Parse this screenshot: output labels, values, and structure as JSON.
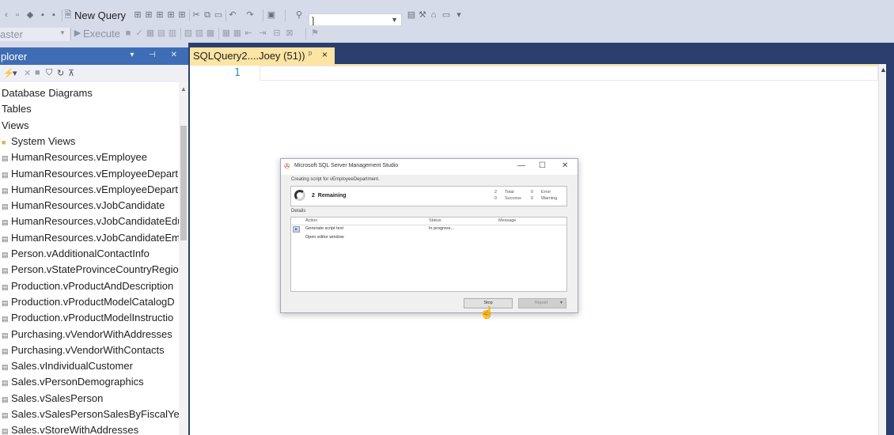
{
  "toolbar": {
    "new_query_label": "New Query",
    "execute_label": "Execute",
    "database_combo_value": "aster",
    "search_combo_value": "]"
  },
  "object_explorer": {
    "title": "plorer",
    "items": [
      {
        "label": "Database Diagrams",
        "icon": "none"
      },
      {
        "label": "Tables",
        "icon": "none"
      },
      {
        "label": "Views",
        "icon": "none"
      },
      {
        "label": "System Views",
        "icon": "folder-icon"
      },
      {
        "label": "HumanResources.vEmployee",
        "icon": "view-icon"
      },
      {
        "label": "HumanResources.vEmployeeDepart",
        "icon": "view-icon"
      },
      {
        "label": "HumanResources.vEmployeeDepart",
        "icon": "view-icon"
      },
      {
        "label": "HumanResources.vJobCandidate",
        "icon": "view-icon"
      },
      {
        "label": "HumanResources.vJobCandidateEdu",
        "icon": "view-icon"
      },
      {
        "label": "HumanResources.vJobCandidateEm",
        "icon": "view-icon"
      },
      {
        "label": "Person.vAdditionalContactInfo",
        "icon": "view-icon"
      },
      {
        "label": "Person.vStateProvinceCountryRegio",
        "icon": "view-icon"
      },
      {
        "label": "Production.vProductAndDescription",
        "icon": "view-icon"
      },
      {
        "label": "Production.vProductModelCatalogD",
        "icon": "view-icon"
      },
      {
        "label": "Production.vProductModelInstructio",
        "icon": "view-icon"
      },
      {
        "label": "Purchasing.vVendorWithAddresses",
        "icon": "view-icon"
      },
      {
        "label": "Purchasing.vVendorWithContacts",
        "icon": "view-icon"
      },
      {
        "label": "Sales.vIndividualCustomer",
        "icon": "view-icon"
      },
      {
        "label": "Sales.vPersonDemographics",
        "icon": "view-icon"
      },
      {
        "label": "Sales.vSalesPerson",
        "icon": "view-icon"
      },
      {
        "label": "Sales.vSalesPersonSalesByFiscalYear",
        "icon": "view-icon"
      },
      {
        "label": "Sales.vStoreWithAddresses",
        "icon": "view-icon"
      }
    ]
  },
  "document": {
    "tab_label": "SQLQuery2....Joey (51))",
    "line_number": "1"
  },
  "dialog": {
    "title": "Microsoft SQL Server Management Studio",
    "subtitle": "Creating script for vEmployeeDepartment.",
    "remaining_count": "2",
    "remaining_label": "Remaining",
    "stats": {
      "total_value": "2",
      "total_label": "Total",
      "success_value": "0",
      "success_label": "Success",
      "error_value": "0",
      "error_label": "Error",
      "warning_value": "0",
      "warning_label": "Warning"
    },
    "details_label": "Details",
    "columns": {
      "action": "Action",
      "status": "Status",
      "message": "Message"
    },
    "rows": [
      {
        "action": "Generate script text",
        "status": "In progress...",
        "message": ""
      },
      {
        "action": "Open editor window",
        "status": "",
        "message": ""
      }
    ],
    "stop_label": "Stop",
    "report_label": "Report"
  },
  "colors": {
    "chrome": "#d6dbe9",
    "panel_header": "#3e6db5",
    "active_tab": "#fce4a3",
    "doc_well": "#2b3f6e"
  }
}
